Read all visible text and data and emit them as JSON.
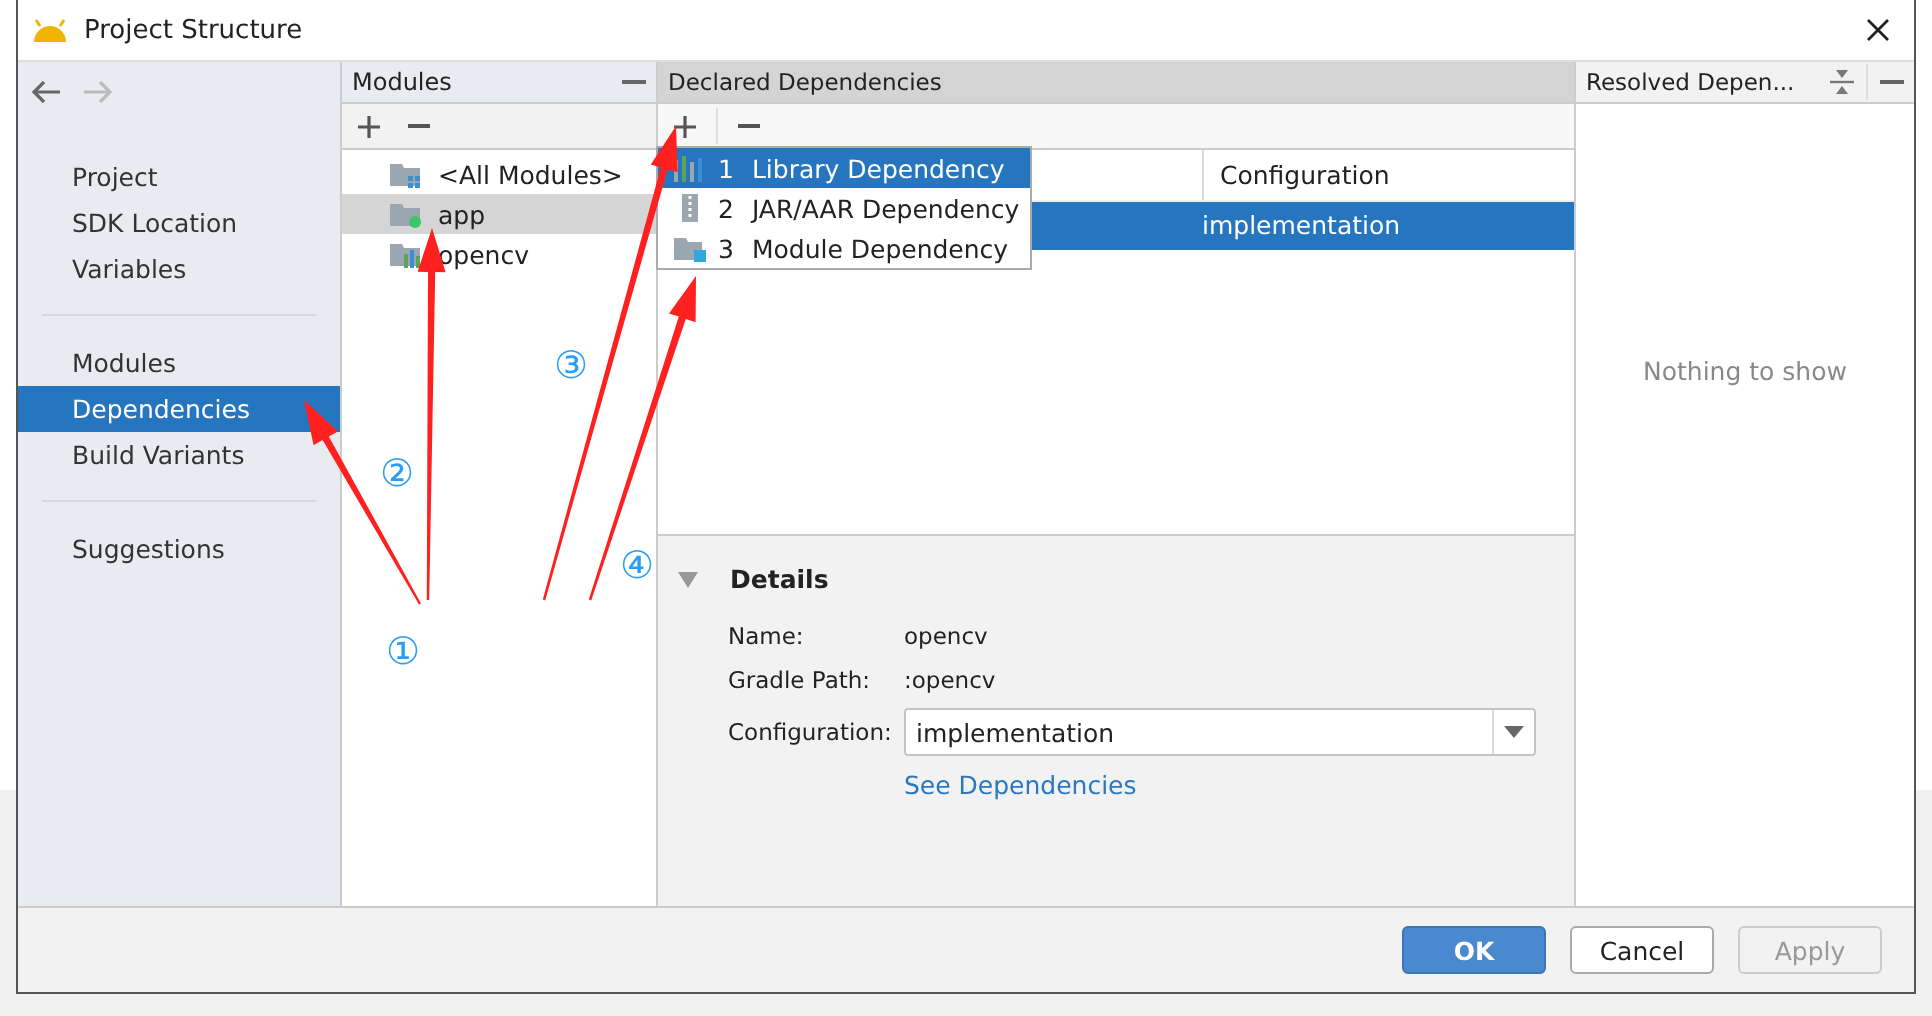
{
  "window": {
    "title": "Project Structure"
  },
  "sidebar": {
    "sections": [
      [
        {
          "label": "Project",
          "selected": false
        },
        {
          "label": "SDK Location",
          "selected": false
        },
        {
          "label": "Variables",
          "selected": false
        }
      ],
      [
        {
          "label": "Modules",
          "selected": false
        },
        {
          "label": "Dependencies",
          "selected": true
        },
        {
          "label": "Build Variants",
          "selected": false
        }
      ],
      [
        {
          "label": "Suggestions",
          "selected": false
        }
      ]
    ]
  },
  "modules_panel": {
    "title": "Modules",
    "items": [
      {
        "label": "<All Modules>",
        "kind": "all",
        "selected": false
      },
      {
        "label": "app",
        "kind": "app",
        "selected": true
      },
      {
        "label": "opencv",
        "kind": "library",
        "selected": false
      }
    ]
  },
  "declared": {
    "title": "Declared Dependencies",
    "columns": [
      "Configuration"
    ],
    "rows": [
      {
        "configuration": "implementation",
        "selected": true
      }
    ]
  },
  "add_menu": {
    "items": [
      {
        "number": "1",
        "label": "Library Dependency",
        "kind": "library",
        "selected": true
      },
      {
        "number": "2",
        "label": "JAR/AAR Dependency",
        "kind": "jar",
        "selected": false
      },
      {
        "number": "3",
        "label": "Module Dependency",
        "kind": "module",
        "selected": false
      }
    ]
  },
  "details": {
    "title": "Details",
    "expanded": true,
    "fields": [
      {
        "label": "Name:",
        "value": "opencv"
      },
      {
        "label": "Gradle Path:",
        "value": ":opencv"
      }
    ],
    "configuration": {
      "label": "Configuration:",
      "value": "implementation"
    },
    "link": "See Dependencies"
  },
  "resolved": {
    "title": "Resolved Depen...",
    "empty_text": "Nothing to show"
  },
  "buttons": [
    {
      "label": "OK",
      "kind": "primary",
      "disabled": false
    },
    {
      "label": "Cancel",
      "kind": "normal",
      "disabled": false
    },
    {
      "label": "Apply",
      "kind": "normal",
      "disabled": true
    }
  ],
  "annotations": [
    {
      "label": "①"
    },
    {
      "label": "②"
    },
    {
      "label": "③"
    },
    {
      "label": "④"
    }
  ]
}
